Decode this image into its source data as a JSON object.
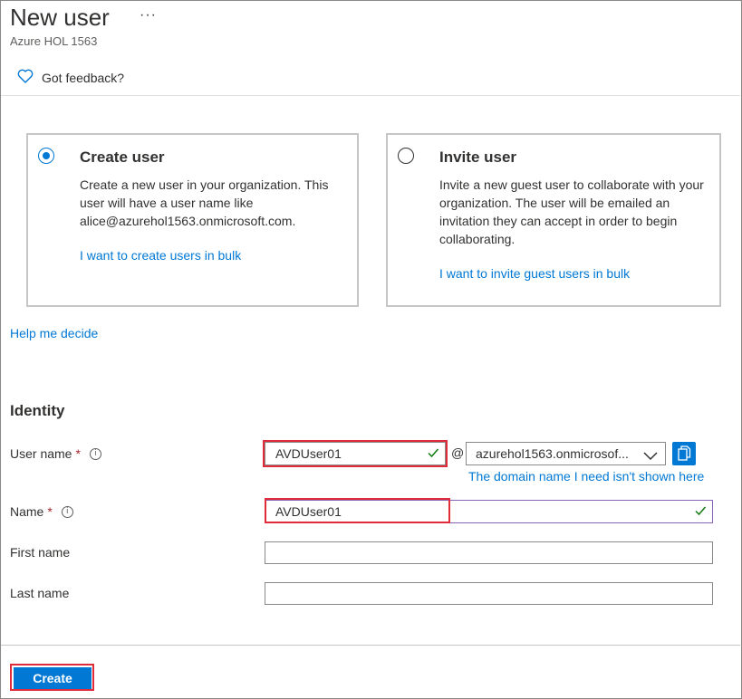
{
  "header": {
    "title": "New user",
    "more_label": "···",
    "subtitle": "Azure HOL 1563",
    "feedback_label": "Got feedback?"
  },
  "options": [
    {
      "title": "Create user",
      "selected": true,
      "description": "Create a new user in your organization. This user will have a user name like alice@azurehol1563.onmicrosoft.com.",
      "link": "I want to create users in bulk"
    },
    {
      "title": "Invite user",
      "selected": false,
      "description": "Invite a new guest user to collaborate with your organization. The user will be emailed an invitation they can accept in order to begin collaborating.",
      "link": "I want to invite guest users in bulk"
    }
  ],
  "help_link": "Help me decide",
  "identity": {
    "section_title": "Identity",
    "username_label": "User name",
    "username_value": "AVDUser01",
    "at_sign": "@",
    "domain_value": "azurehol1563.onmicrosof...",
    "domain_link": "The domain name I need isn't shown here",
    "name_label": "Name",
    "name_value": "AVDUser01",
    "first_name_label": "First name",
    "first_name_value": "",
    "last_name_label": "Last name",
    "last_name_value": "",
    "required_mark": "*",
    "info_glyph": "i"
  },
  "footer": {
    "create_label": "Create"
  },
  "colors": {
    "accent": "#0078d4",
    "required": "#a4262c",
    "highlight": "#e02b3a",
    "valid_check": "#107c10",
    "focus_border": "#8764b8"
  }
}
